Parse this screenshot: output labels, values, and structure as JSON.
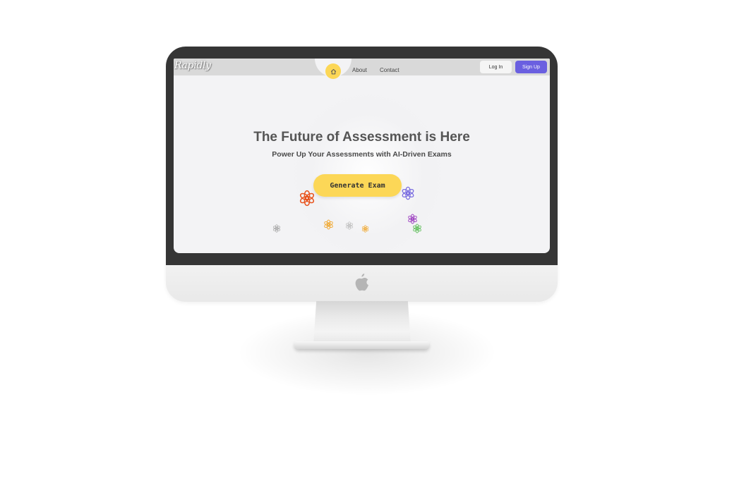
{
  "site": {
    "brand": "Rapidly",
    "nav": {
      "home_icon": "home-icon",
      "links": [
        "About",
        "Contact"
      ],
      "login_label": "Log In",
      "signup_label": "Sign Up"
    },
    "hero": {
      "title": "The Future of Assessment is Here",
      "subtitle": "Power Up Your Assessments with AI-Driven Exams",
      "cta_label": "Generate Exam"
    },
    "decorations": {
      "icon": "openai-knot-icon",
      "colors": [
        "#e8541e",
        "#7b6ee0",
        "#f0a830",
        "#a9a9a9",
        "#c0c0c0",
        "#f0a830",
        "#9c3fc0",
        "#5fbf5a"
      ]
    }
  },
  "device": {
    "logo_icon": "apple-logo-icon"
  },
  "colors": {
    "accent_yellow": "#fcd757",
    "signup_purple": "#6a5fe0",
    "bezel": "#353535",
    "navbar": "#d9d9d9"
  }
}
